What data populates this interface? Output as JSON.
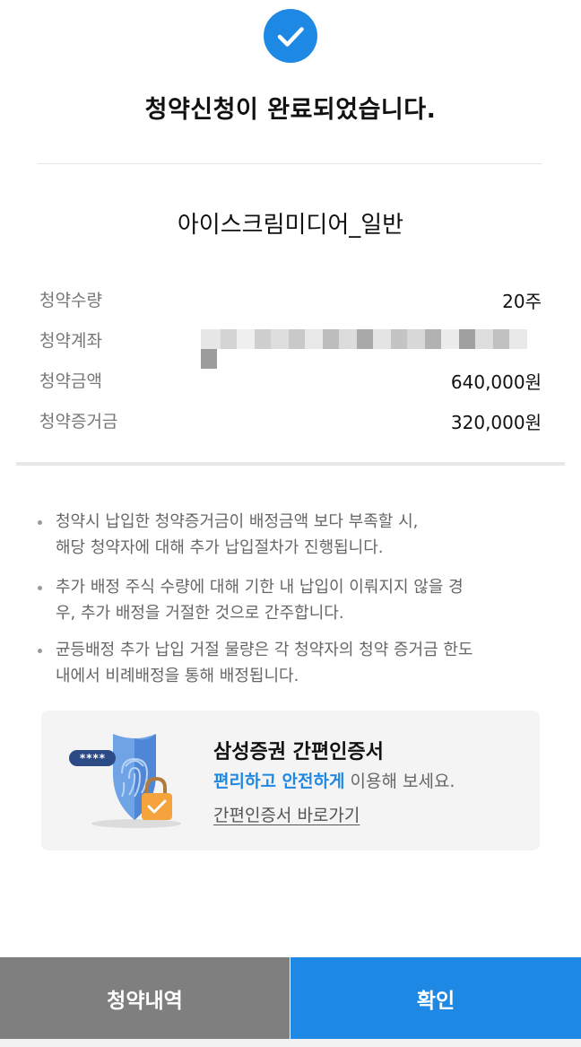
{
  "completion": {
    "title": "청약신청이 완료되었습니다."
  },
  "product": {
    "name": "아이스크림미디어_일반"
  },
  "info": {
    "rows": [
      {
        "label": "청약수량",
        "value": "20주"
      },
      {
        "label": "청약계좌",
        "value": ""
      },
      {
        "label": "청약금액",
        "value": "640,000원"
      },
      {
        "label": "청약증거금",
        "value": "320,000원"
      }
    ]
  },
  "notices": [
    {
      "lines": [
        "청약시 납입한 청약증거금이 배정금액 보다 부족할 시,",
        "해당 청약자에 대해 추가 납입절차가 진행됩니다."
      ]
    },
    {
      "lines": [
        "추가 배정 주식 수량에 대해 기한 내 납입이 이뤄지지 않을 경",
        "우, 추가 배정을 거절한 것으로 간주합니다."
      ]
    },
    {
      "lines": [
        "균등배정 추가 납입 거절 물량은 각 청약자의 청약 증거금 한도",
        "내에서 비례배정을 통해 배정됩니다."
      ]
    }
  ],
  "banner": {
    "title": "삼성증권 간편인증서",
    "subtitle_highlight": "편리하고 안전하게",
    "subtitle_rest": " 이용해 보세요.",
    "link": "간편인증서 바로가기",
    "badge_text": "****"
  },
  "buttons": {
    "history": "청약내역",
    "confirm": "확인"
  },
  "colors": {
    "accent": "#1e88e5",
    "secondary_button": "#7f7f7f"
  }
}
